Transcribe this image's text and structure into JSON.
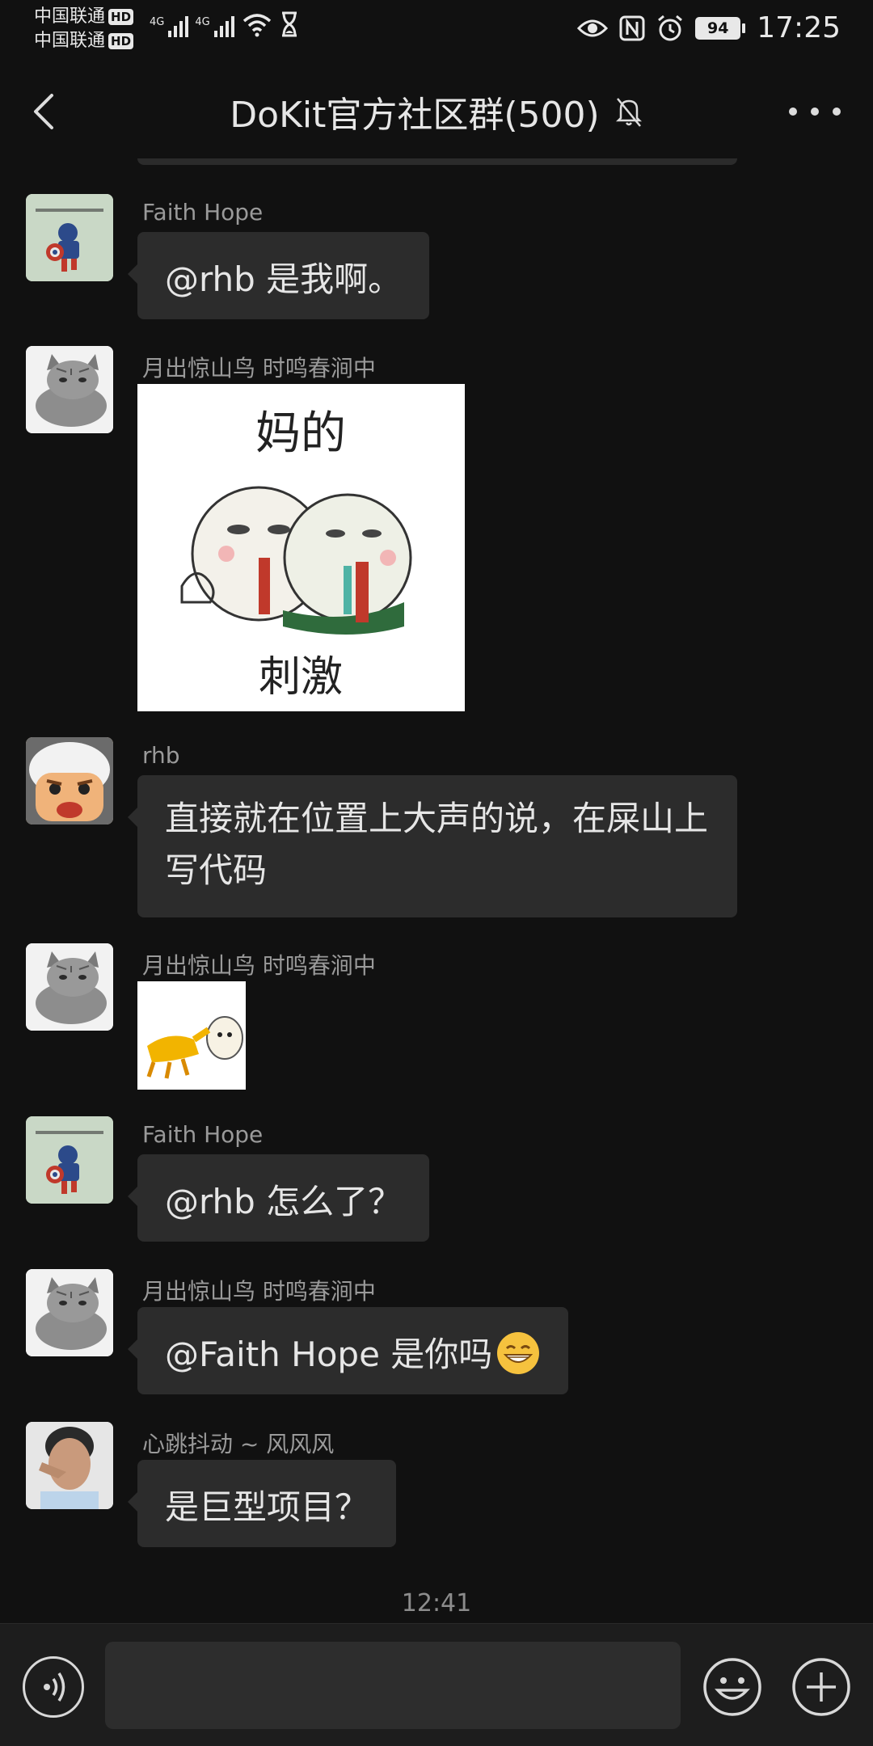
{
  "status_bar": {
    "carrier_1": "中国联通",
    "carrier_2": "中国联通",
    "hd_badge": "HD",
    "network_1": "4G",
    "network_2": "4G",
    "battery": "94",
    "time": "17:25"
  },
  "header": {
    "title": "DoKit官方社区群(500)"
  },
  "messages": [
    {
      "sender": "Faith Hope",
      "text": "@rhb  是我啊。"
    },
    {
      "sender": "月出惊山鸟  时鸣春涧中",
      "sticker_top_text": "妈的",
      "sticker_bottom_text": "刺激"
    },
    {
      "sender": "rhb",
      "text": "直接就在位置上大声的说，在屎山上写代码"
    },
    {
      "sender": "月出惊山鸟  时鸣春涧中"
    },
    {
      "sender": "Faith Hope",
      "text": "@rhb  怎么了？"
    },
    {
      "sender": "月出惊山鸟  时鸣春涧中",
      "text": "@Faith Hope  是你吗"
    },
    {
      "sender": "心跳抖动 ~ 风风风",
      "text": "是巨型项目？"
    }
  ],
  "timestamp": "12:41",
  "input": {
    "value": "",
    "placeholder": ""
  }
}
